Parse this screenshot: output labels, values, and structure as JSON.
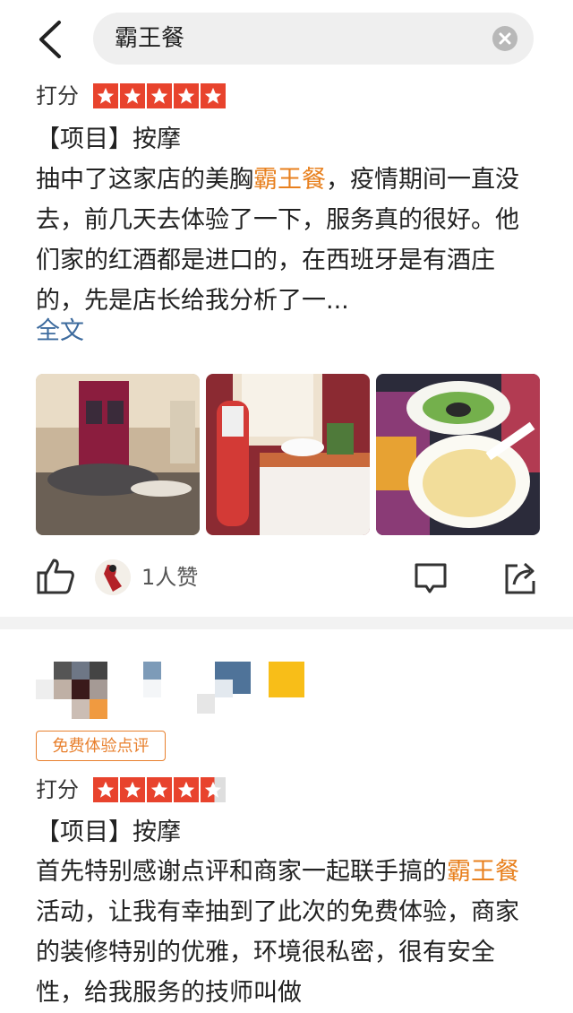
{
  "search": {
    "query": "霸王餐"
  },
  "review1": {
    "rating_label": "打分",
    "rating_value": 5,
    "project": "【项目】按摩",
    "text_parts": {
      "a": "抽中了这家店的美胸",
      "highlight": "霸王餐",
      "b": "，疫情期间一直没去，前几天去体验了一下，服务真的很好。他们家的红酒都是进口的，在西班牙是有酒庄的，先是店长给我分析了一..."
    },
    "more_label": "全文",
    "likes_text": "1人赞"
  },
  "review2": {
    "badge": "免费体验点评",
    "rating_label": "打分",
    "rating_value": 4.5,
    "project": "【项目】按摩",
    "text_parts": {
      "a": "首先特别感谢点评和商家一起联手搞的",
      "highlight": "霸王餐",
      "b": "活动，让我有幸抽到了此次的免费体验，商家的装修特别的优雅，环境很私密，很有安全性，给我服务的技师叫做"
    }
  },
  "colors": {
    "star": "#e8432d",
    "highlight": "#e8801e",
    "link": "#3d6b9e"
  }
}
